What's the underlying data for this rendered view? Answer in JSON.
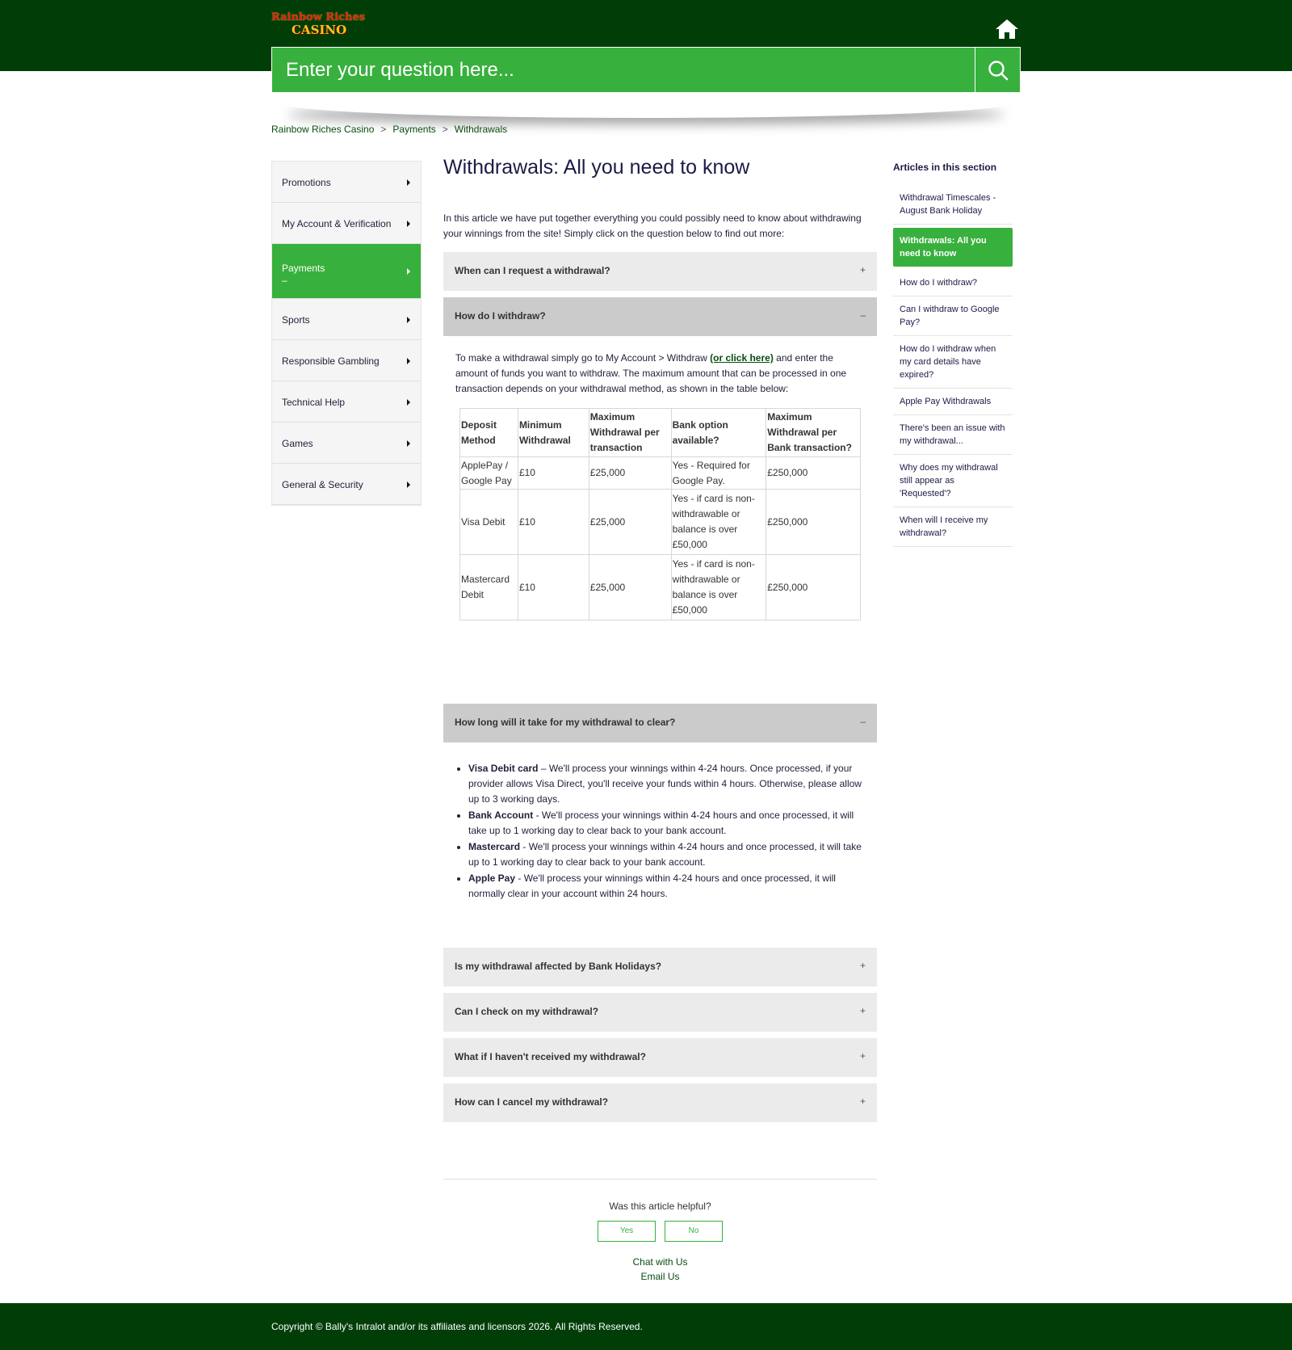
{
  "header": {
    "logo_line1": "Rainbow Riches",
    "logo_line2": "CASINO",
    "home_icon": "home-icon"
  },
  "search": {
    "placeholder": "Enter your question here...",
    "icon": "search-icon"
  },
  "breadcrumb": [
    "Rainbow Riches Casino",
    "Payments",
    "Withdrawals"
  ],
  "breadcrumb_sep": ">",
  "sidenav": {
    "items": [
      {
        "label": "Promotions"
      },
      {
        "label": "My Account & Verification"
      },
      {
        "label": "Payments",
        "active": true,
        "sub": "–"
      },
      {
        "label": "Sports"
      },
      {
        "label": "Responsible Gambling"
      },
      {
        "label": "Technical Help"
      },
      {
        "label": "Games"
      },
      {
        "label": "General & Security"
      }
    ]
  },
  "article": {
    "title": "Withdrawals: All you need to know",
    "intro": "In this article we have put together everything you could possibly need to know about withdrawing your winnings from the site! Simply click on the question below to find out more:",
    "accordions": [
      {
        "q": "When can I request a withdrawal?",
        "sign": "+"
      },
      {
        "q": "How do I withdraw?",
        "sign": "–"
      },
      {
        "q": "How long will it take for my withdrawal to clear?",
        "sign": "–"
      },
      {
        "q": "Is my withdrawal affected by Bank Holidays?",
        "sign": "+"
      },
      {
        "q": "Can I check on my withdrawal?",
        "sign": "+"
      },
      {
        "q": "What if I haven't received my withdrawal?",
        "sign": "+"
      },
      {
        "q": "How can I cancel my withdrawal?",
        "sign": "+"
      }
    ],
    "withdraw_text_pre": "To make a withdrawal simply go to My Account > Withdraw ",
    "withdraw_link": "(or click here)",
    "withdraw_text_post": " and enter the amount of funds you want to withdraw. The maximum amount that can be processed in one transaction depends on your withdrawal method, as shown in the table below:",
    "table": {
      "headers": [
        "Deposit Method",
        "Minimum Withdrawal",
        "Maximum Withdrawal per transaction",
        "Bank option available?",
        "Maximum Withdrawal per Bank transaction?"
      ],
      "rows": [
        [
          "ApplePay / Google Pay",
          "£10",
          "£25,000",
          "Yes - Required for Google Pay.",
          "£250,000"
        ],
        [
          "Visa Debit",
          "£10",
          "£25,000",
          "Yes - if card is non-withdrawable or balance is over £50,000",
          "£250,000"
        ],
        [
          "Mastercard Debit",
          "£10",
          "£25,000",
          "Yes - if card is non-withdrawable or balance is over £50,000",
          "£250,000"
        ]
      ]
    },
    "clear_times": [
      {
        "name": "Visa Debit card",
        "text": " – We'll process your winnings within 4-24 hours. Once processed, if your provider allows Visa Direct, you'll receive your funds within 4 hours. Otherwise, please allow up to 3 working days."
      },
      {
        "name": "Bank Account",
        "text": " - We'll process your winnings within 4-24 hours and once processed, it will take up to 1 working day to clear back to your bank account."
      },
      {
        "name": "Mastercard",
        "text": " - We'll process your winnings within 4-24 hours and once processed, it will take up to 1 working day to clear back to your bank account."
      },
      {
        "name": "Apple Pay",
        "text": " - We'll process your winnings within 4-24 hours and once processed, it will normally clear in your account within 24 hours."
      }
    ],
    "helpful": {
      "question": "Was this article helpful?",
      "yes": "Yes",
      "no": "No"
    },
    "chat": "Chat with Us",
    "email": "Email Us"
  },
  "aside": {
    "title": "Articles in this section",
    "articles": [
      {
        "label": "Withdrawal Timescales - August Bank Holiday"
      },
      {
        "label": "Withdrawals: All you need to know",
        "active": true
      },
      {
        "label": "How do I withdraw?"
      },
      {
        "label": "Can I withdraw to Google Pay?"
      },
      {
        "label": "How do I withdraw when my card details have expired?"
      },
      {
        "label": "Apple Pay Withdrawals"
      },
      {
        "label": "There's been an issue with my withdrawal..."
      },
      {
        "label": "Why does my withdrawal still appear as 'Requested'?"
      },
      {
        "label": "When will I receive my withdrawal?"
      }
    ]
  },
  "footer": {
    "copyright": "Copyright © Bally's Intralot and/or its affiliates and licensors 2026. All Rights Reserved."
  },
  "colors": {
    "header_bg": "#013e07",
    "accent_green": "#38b03d",
    "link_green": "#0a4d0f"
  }
}
